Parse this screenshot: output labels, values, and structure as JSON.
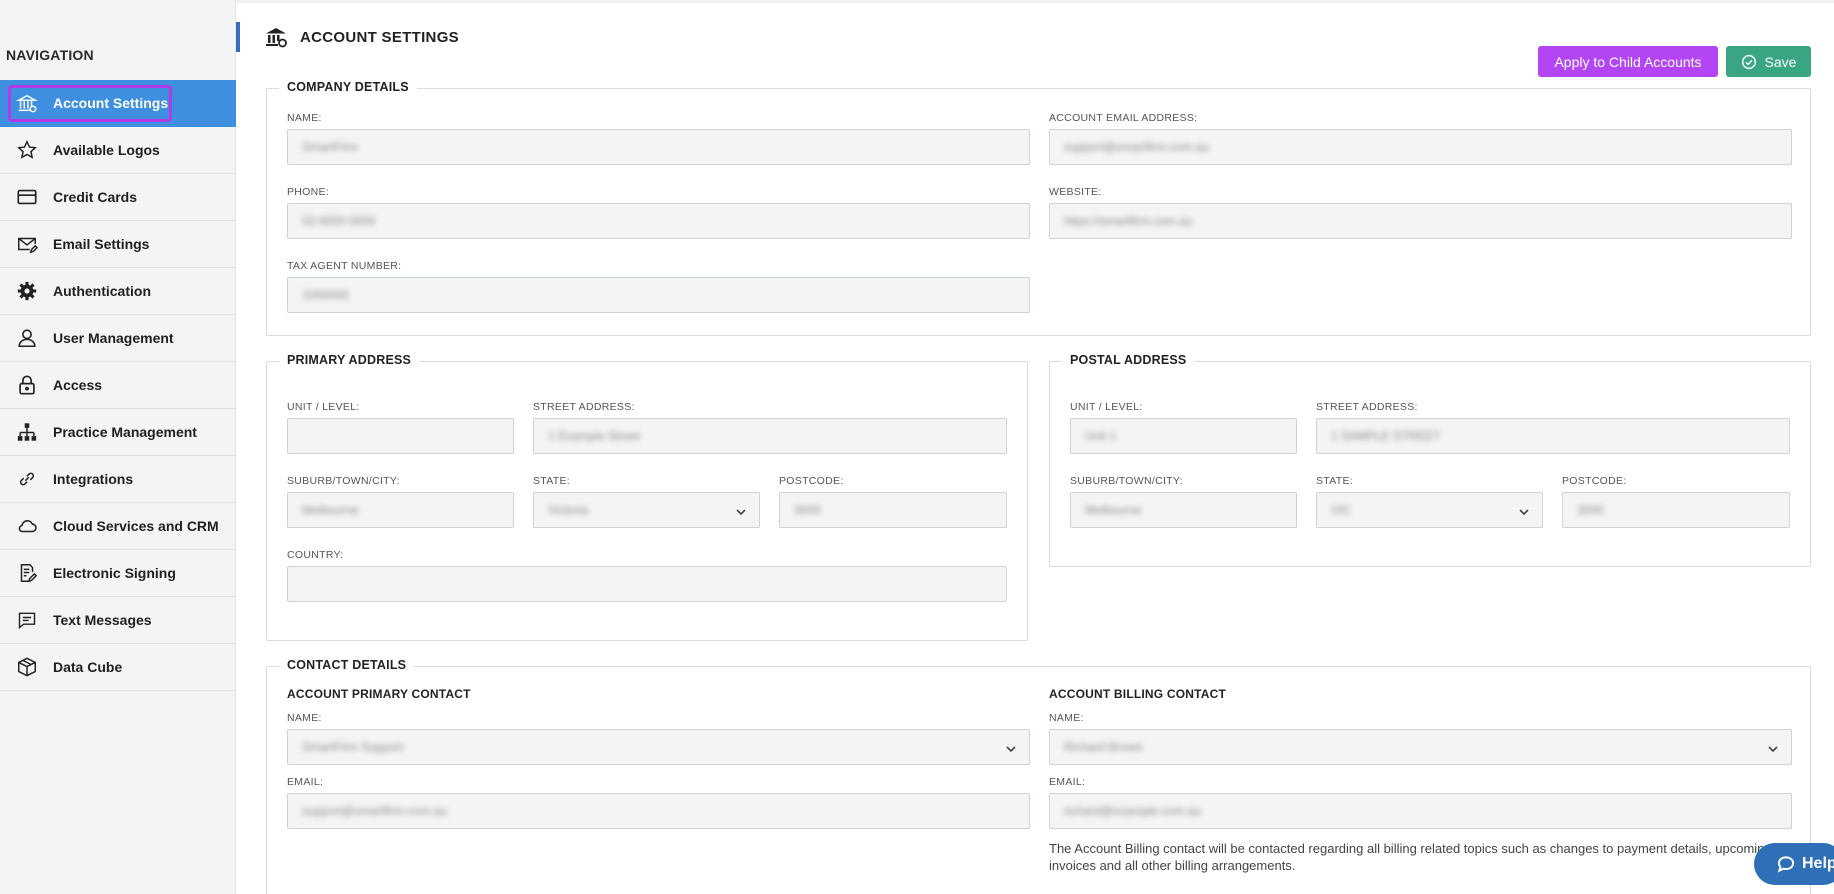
{
  "sidebar": {
    "title": "NAVIGATION",
    "items": [
      {
        "label": "Account Settings",
        "icon": "bank-icon",
        "active": true
      },
      {
        "label": "Available Logos",
        "icon": "star-icon"
      },
      {
        "label": "Credit Cards",
        "icon": "credit-card-icon"
      },
      {
        "label": "Email Settings",
        "icon": "envelope-edit-icon"
      },
      {
        "label": "Authentication",
        "icon": "gear-icon"
      },
      {
        "label": "User Management",
        "icon": "user-icon"
      },
      {
        "label": "Access",
        "icon": "lock-icon"
      },
      {
        "label": "Practice Management",
        "icon": "org-chart-icon"
      },
      {
        "label": "Integrations",
        "icon": "link-icon"
      },
      {
        "label": "Cloud Services and CRM",
        "icon": "cloud-icon"
      },
      {
        "label": "Electronic Signing",
        "icon": "document-sign-icon"
      },
      {
        "label": "Text Messages",
        "icon": "message-icon"
      },
      {
        "label": "Data Cube",
        "icon": "cube-icon"
      }
    ]
  },
  "header": {
    "title": "ACCOUNT SETTINGS",
    "apply_label": "Apply to Child Accounts",
    "save_label": "Save"
  },
  "company": {
    "legend": "COMPANY DETAILS",
    "name_label": "NAME:",
    "name_value": "SmartFirm",
    "email_label": "ACCOUNT EMAIL ADDRESS:",
    "email_value": "support@smartfirm.com.au",
    "phone_label": "PHONE:",
    "phone_value": "03 9000 0000",
    "website_label": "WEBSITE:",
    "website_value": "https://smartfirm.com.au",
    "tax_label": "TAX AGENT NUMBER:",
    "tax_value": "1000000"
  },
  "primary": {
    "legend": "PRIMARY ADDRESS",
    "unit_label": "UNIT / LEVEL:",
    "unit_value": "",
    "street_label": "STREET ADDRESS:",
    "street_value": "1 Example Street",
    "suburb_label": "SUBURB/TOWN/CITY:",
    "suburb_value": "Melbourne",
    "state_label": "STATE:",
    "state_value": "Victoria",
    "postcode_label": "POSTCODE:",
    "postcode_value": "3000",
    "country_label": "COUNTRY:",
    "country_value": ""
  },
  "postal": {
    "legend": "POSTAL ADDRESS",
    "unit_label": "UNIT / LEVEL:",
    "unit_value": "Unit 1",
    "street_label": "STREET ADDRESS:",
    "street_value": "1 SAMPLE STREET",
    "suburb_label": "SUBURB/TOWN/CITY:",
    "suburb_value": "Melbourne",
    "state_label": "STATE:",
    "state_value": "VIC",
    "postcode_label": "POSTCODE:",
    "postcode_value": "3000"
  },
  "contact": {
    "legend": "CONTACT DETAILS",
    "primary_head": "ACCOUNT PRIMARY CONTACT",
    "primary_name_label": "NAME:",
    "primary_name_value": "SmartFirm Support",
    "primary_email_label": "EMAIL:",
    "primary_email_value": "support@smartfirm.com.au",
    "billing_head": "ACCOUNT BILLING CONTACT",
    "billing_name_label": "NAME:",
    "billing_name_value": "Richard Brown",
    "billing_email_label": "EMAIL:",
    "billing_email_value": "richard@example.com.au",
    "billing_note": "The Account Billing contact will be contacted regarding all billing related topics such as changes to payment details, upcoming invoices and all other billing arrangements."
  },
  "help": {
    "label": "Help"
  }
}
